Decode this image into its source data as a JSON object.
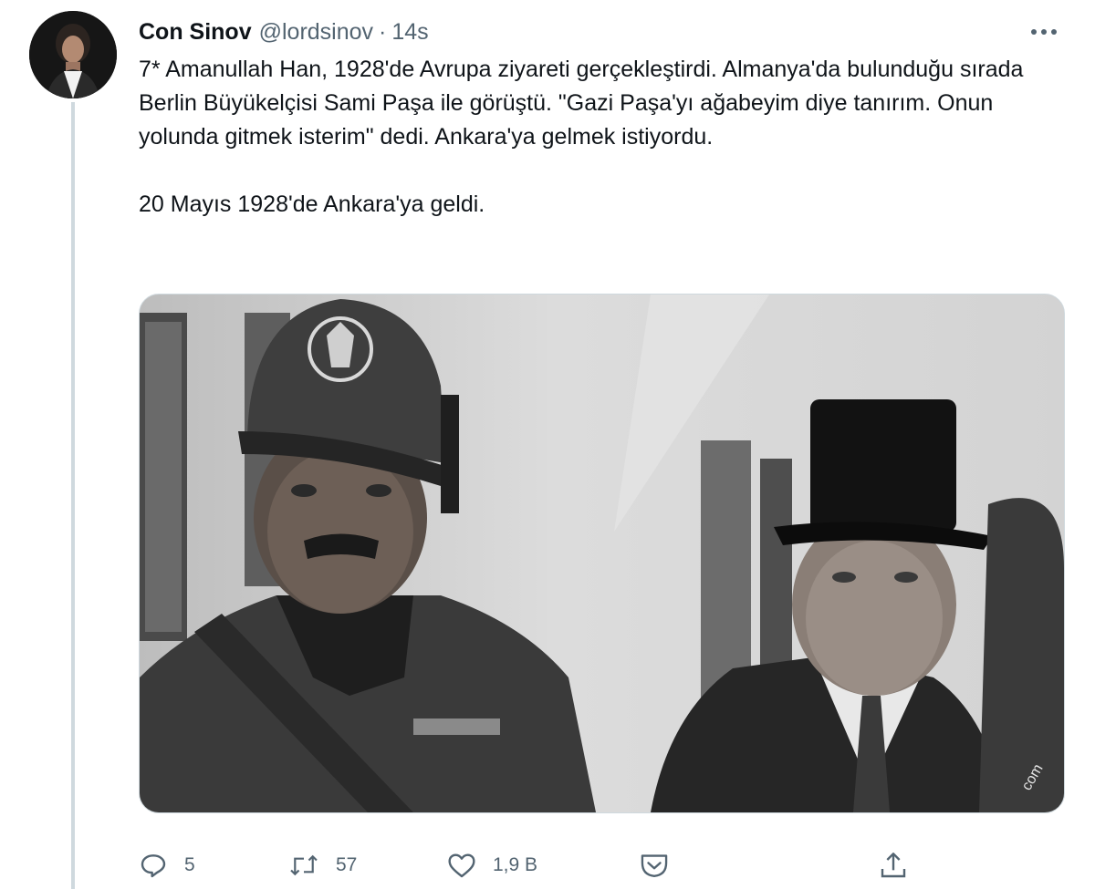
{
  "tweet": {
    "author": {
      "display_name": "Con Sinov",
      "handle": "@lordsinov",
      "separator": "·",
      "time": "14s"
    },
    "text_paragraphs": [
      "7* Amanullah Han, 1928'de Avrupa ziyareti gerçekleştirdi. Almanya'da bulunduğu sırada Berlin Büyükelçisi Sami Paşa ile görüştü. \"Gazi Paşa'yı ağabeyim diye tanırım. Onun yolunda gitmek isterim\" dedi. Ankara'ya gelmek istiyordu.",
      "20 Mayıs 1928'de Ankara'ya geldi."
    ],
    "media": {
      "kind": "black-and-white photograph",
      "watermark_fragment": "com"
    },
    "actions": {
      "reply": {
        "icon": "reply-icon",
        "count": "5"
      },
      "retweet": {
        "icon": "retweet-icon",
        "count": "57"
      },
      "like": {
        "icon": "heart-icon",
        "count": "1,9 B"
      },
      "tip": {
        "icon": "tip-jar-icon",
        "count": ""
      },
      "share": {
        "icon": "share-icon",
        "count": ""
      }
    },
    "more_icon": "more-icon"
  },
  "colors": {
    "text_primary": "#0f1419",
    "text_secondary": "#536471",
    "thread_line": "#cfd9de",
    "border": "#cfd9de"
  }
}
